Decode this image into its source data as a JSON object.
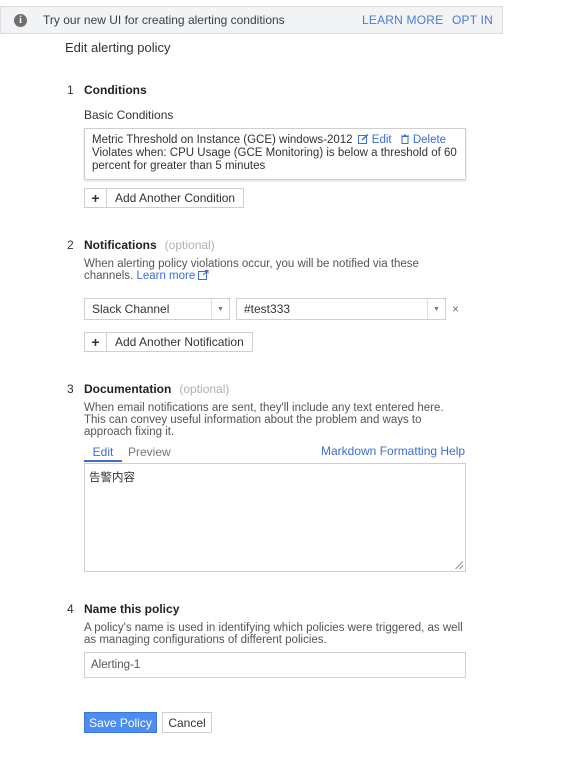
{
  "banner": {
    "message": "Try our new UI for creating alerting conditions",
    "learn_more": "LEARN MORE",
    "opt_in": "OPT IN",
    "info_icon": "info-icon"
  },
  "page_title": "Edit alerting policy",
  "steps": {
    "conditions": {
      "number": "1",
      "title": "Conditions",
      "subtitle": "Basic Conditions",
      "condition": {
        "name": "Metric Threshold on Instance (GCE) windows-2012",
        "edit_label": "Edit",
        "delete_label": "Delete",
        "description": "Violates when: CPU Usage (GCE Monitoring) is below a threshold of 60 percent for greater than 5 minutes"
      },
      "add_button": "Add Another Condition"
    },
    "notifications": {
      "number": "2",
      "title": "Notifications",
      "optional": "(optional)",
      "description": "When alerting policy violations occur, you will be notified via these channels.",
      "learn_more": "Learn more",
      "channel_type": "Slack Channel",
      "channel_value": "#test333",
      "remove": "×",
      "add_button": "Add Another Notification"
    },
    "documentation": {
      "number": "3",
      "title": "Documentation",
      "optional": "(optional)",
      "description": "When email notifications are sent, they'll include any text entered here. This can convey useful information about the problem and ways to approach fixing it.",
      "tab_edit": "Edit",
      "tab_preview": "Preview",
      "markdown_help": "Markdown Formatting Help",
      "content": "告警内容"
    },
    "name": {
      "number": "4",
      "title": "Name this policy",
      "description": "A policy's name is used in identifying which policies were triggered, as well as managing configurations of different policies.",
      "value": "Alerting-1"
    }
  },
  "actions": {
    "save": "Save Policy",
    "cancel": "Cancel"
  },
  "colors": {
    "accent": "#4d8cf0",
    "link": "#3a6fd0"
  }
}
